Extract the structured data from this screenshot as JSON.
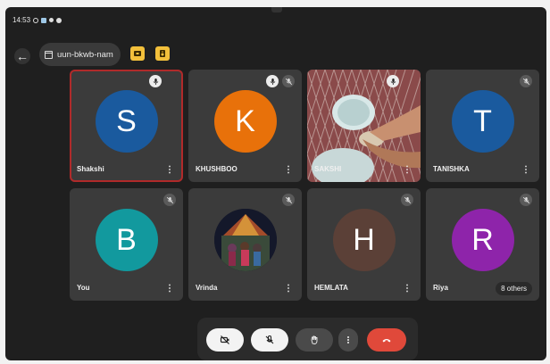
{
  "status": {
    "time": "14:53"
  },
  "header": {
    "meeting_code": "uun-bkwb-nam"
  },
  "participants": [
    {
      "name": "Shakshi",
      "initial": "S",
      "color": "#1a5a9e",
      "avatar": "letter",
      "mic": "speaking"
    },
    {
      "name": "KHUSHBOO",
      "initial": "K",
      "color": "#e8710a",
      "avatar": "letter",
      "mic": "speaking-muted"
    },
    {
      "name": "SAKSHI",
      "initial": "",
      "color": "",
      "avatar": "video",
      "mic": "speaking"
    },
    {
      "name": "TANISHKA",
      "initial": "T",
      "color": "#1a5a9e",
      "avatar": "letter",
      "mic": "muted"
    },
    {
      "name": "You",
      "initial": "B",
      "color": "#12999e",
      "avatar": "letter",
      "mic": "muted"
    },
    {
      "name": "Vrinda",
      "initial": "",
      "color": "",
      "avatar": "photo",
      "mic": "muted"
    },
    {
      "name": "HEMLATA",
      "initial": "H",
      "color": "#5b4037",
      "avatar": "letter",
      "mic": "muted"
    },
    {
      "name": "Riya",
      "initial": "R",
      "color": "#8e24aa",
      "avatar": "letter",
      "mic": "muted"
    }
  ],
  "others_label": "8 others",
  "controls": {
    "camera": "camera-off-icon",
    "mic": "mic-off-icon",
    "hand": "raise-hand-icon",
    "more": "more-options-icon",
    "leave": "end-call-icon"
  },
  "colors": {
    "active_border": "#b02a2a",
    "leave": "#e0493a",
    "highlight": "#f3c03b",
    "tile": "#3b3b3b"
  }
}
